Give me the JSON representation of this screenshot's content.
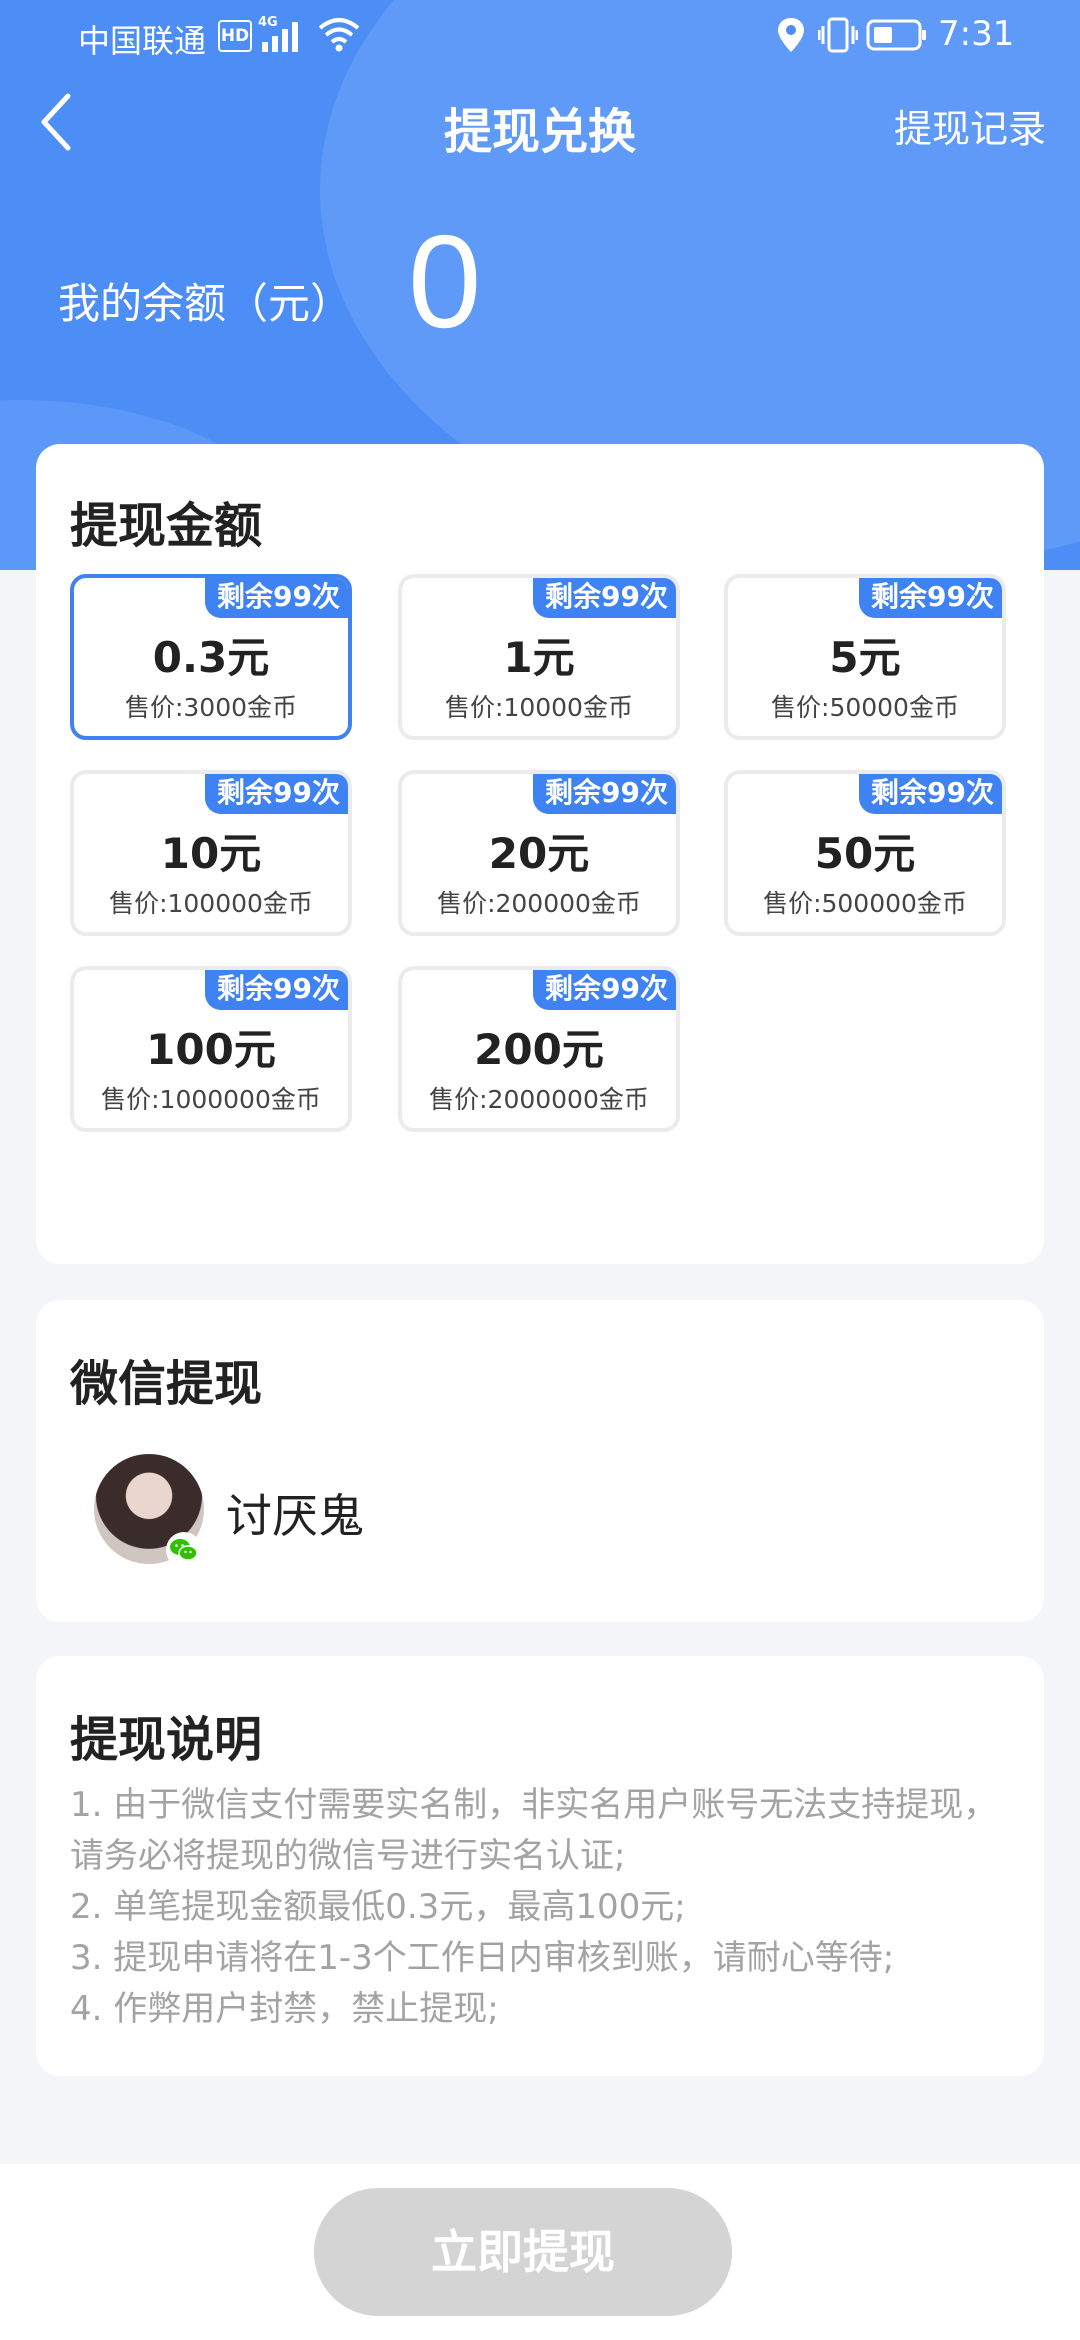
{
  "status_bar": {
    "carrier": "中国联通",
    "hd_label": "HD",
    "network_label": "4G",
    "time": "7:31"
  },
  "header": {
    "title": "提现兑换",
    "right_link": "提现记录",
    "balance_label": "我的余额（元）",
    "balance_value": "0"
  },
  "amount_section": {
    "title": "提现金额",
    "options": [
      {
        "amount": "0.3元",
        "price": "售价:3000金币",
        "badge": "剩余99次",
        "selected": true
      },
      {
        "amount": "1元",
        "price": "售价:10000金币",
        "badge": "剩余99次",
        "selected": false
      },
      {
        "amount": "5元",
        "price": "售价:50000金币",
        "badge": "剩余99次",
        "selected": false
      },
      {
        "amount": "10元",
        "price": "售价:100000金币",
        "badge": "剩余99次",
        "selected": false
      },
      {
        "amount": "20元",
        "price": "售价:200000金币",
        "badge": "剩余99次",
        "selected": false
      },
      {
        "amount": "50元",
        "price": "售价:500000金币",
        "badge": "剩余99次",
        "selected": false
      },
      {
        "amount": "100元",
        "price": "售价:1000000金币",
        "badge": "剩余99次",
        "selected": false
      },
      {
        "amount": "200元",
        "price": "售价:2000000金币",
        "badge": "剩余99次",
        "selected": false
      }
    ]
  },
  "wechat_section": {
    "title": "微信提现",
    "user_name": "讨厌鬼"
  },
  "notes_section": {
    "title": "提现说明",
    "lines": [
      "1. 由于微信支付需要实名制，非实名用户账号无法支持提现，",
      "请务必将提现的微信号进行实名认证;",
      "2. 单笔提现金额最低0.3元，最高100元;",
      "3. 提现申请将在1-3个工作日内审核到账，请耐心等待;",
      "4. 作弊用户封禁，禁止提现;"
    ]
  },
  "submit_label": "立即提现",
  "colors": {
    "primary": "#3e82f3",
    "header_bg": "#4c8df6",
    "button_disabled": "#d4d4d4",
    "wechat_green": "#2dc100"
  }
}
